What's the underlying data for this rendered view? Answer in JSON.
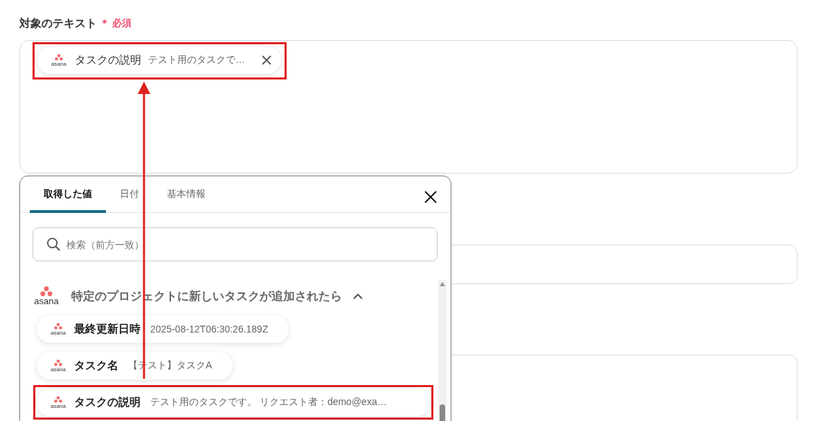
{
  "field": {
    "label": "対象のテキスト",
    "required_mark": "＊",
    "required_label": "必須",
    "token": {
      "logo": "asana",
      "name": "タスクの説明",
      "value": "テスト用のタスクで…",
      "highlighted": true
    }
  },
  "popup": {
    "tabs": [
      {
        "label": "取得した値",
        "selected": true
      },
      {
        "label": "日付",
        "selected": false
      },
      {
        "label": "基本情報",
        "selected": false
      }
    ],
    "search": {
      "placeholder": "検索（前方一致）"
    },
    "group": {
      "logo": "asana",
      "title": "特定のプロジェクトに新しいタスクが追加されたら",
      "expanded": true
    },
    "items": [
      {
        "logo": "asana",
        "name": "最終更新日時",
        "value": "2025-08-12T06:30:26.189Z",
        "highlighted": false
      },
      {
        "logo": "asana",
        "name": "タスク名",
        "value": "【テスト】タスクA",
        "highlighted": false
      },
      {
        "logo": "asana",
        "name": "タスクの説明",
        "value": "テスト用のタスクです。 リクエスト者：demo@exa…",
        "highlighted": true
      }
    ]
  }
}
